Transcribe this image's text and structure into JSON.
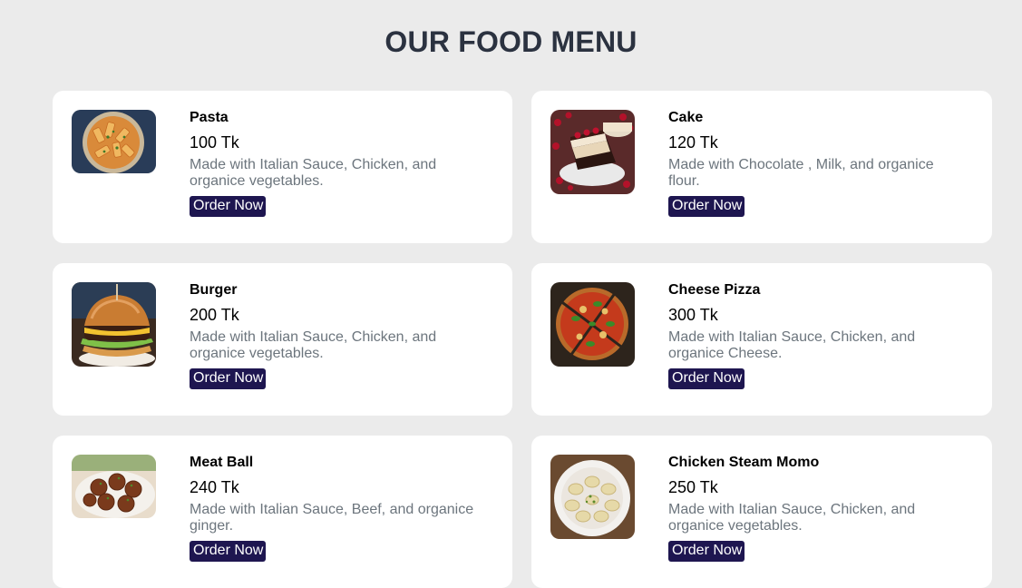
{
  "page": {
    "title": "OUR FOOD MENU"
  },
  "colors": {
    "background": "#ebebeb",
    "card": "#ffffff",
    "title": "#2b3240",
    "description": "#6c757d",
    "button": "#1e1650"
  },
  "menu": {
    "items": [
      {
        "name": "Pasta",
        "price": "100 Tk",
        "description": "Made with Italian Sauce, Chicken, and organice vegetables.",
        "button_label": "Order Now",
        "image": "pasta-bowl"
      },
      {
        "name": "Cake",
        "price": "120 Tk",
        "description": "Made with Chocolate , Milk, and organice flour.",
        "button_label": "Order Now",
        "image": "cheesecake-slice"
      },
      {
        "name": "Burger",
        "price": "200 Tk",
        "description": "Made with Italian Sauce, Chicken, and organice vegetables.",
        "button_label": "Order Now",
        "image": "burger"
      },
      {
        "name": "Cheese Pizza",
        "price": "300 Tk",
        "description": "Made with Italian Sauce, Chicken, and organice Cheese.",
        "button_label": "Order Now",
        "image": "pizza"
      },
      {
        "name": "Meat Ball",
        "price": "240 Tk",
        "description": "Made with Italian Sauce, Beef, and organice ginger.",
        "button_label": "Order Now",
        "image": "meatballs-bowl"
      },
      {
        "name": "Chicken Steam Momo",
        "price": "250 Tk",
        "description": "Made with Italian Sauce, Chicken, and organice vegetables.",
        "button_label": "Order Now",
        "image": "momo-plate"
      }
    ]
  }
}
